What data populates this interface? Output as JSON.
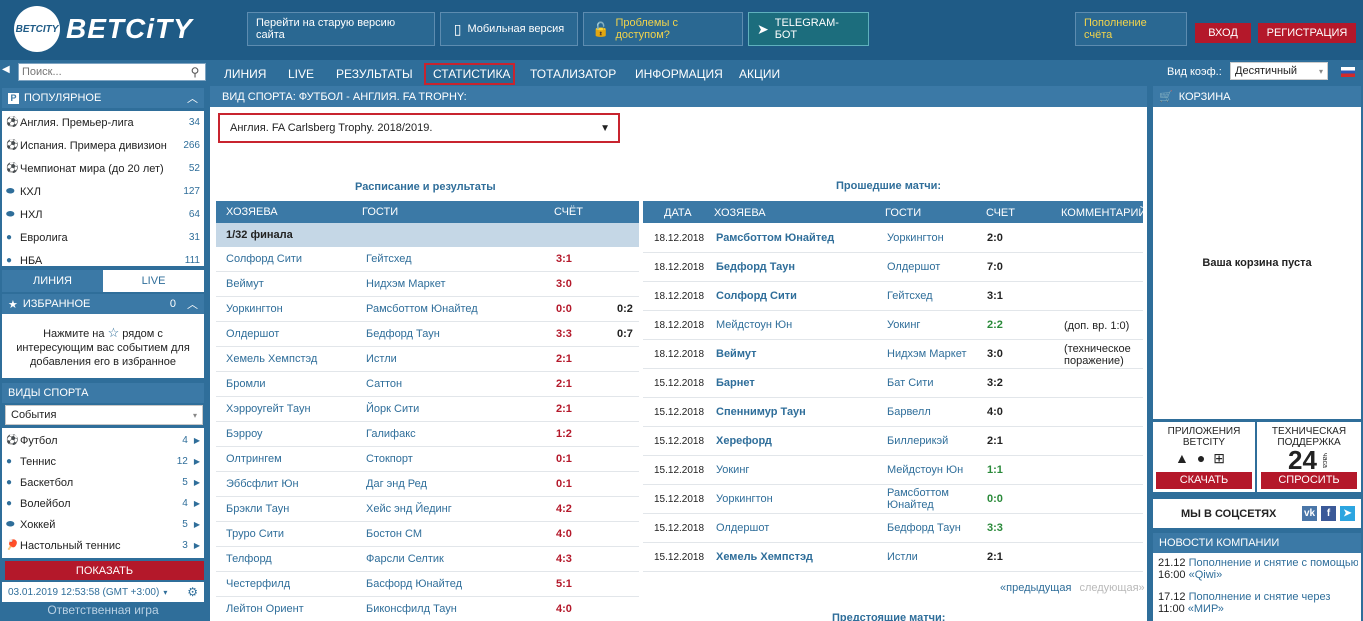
{
  "header": {
    "logo_ball": "BETCITY",
    "logo_text": "BETCiTY",
    "old_site": "Перейти на старую версию сайта",
    "mobile": "Мобильная версия",
    "access": "Проблемы с доступом?",
    "telegram": "TELEGRAM-БОТ",
    "deposit": "Пополнение счёта",
    "login": "ВХОД",
    "register": "РЕГИСТРАЦИЯ"
  },
  "search": {
    "placeholder": "Поиск..."
  },
  "nav": {
    "items": [
      "ЛИНИЯ",
      "LIVE",
      "РЕЗУЛЬТАТЫ",
      "СТАТИСТИКА",
      "ТОТАЛИЗАТОР",
      "ИНФОРМАЦИЯ",
      "АКЦИИ"
    ],
    "active": "СТАТИСТИКА",
    "koef_label": "Вид коэф.:",
    "koef_value": "Десятичный"
  },
  "popular": {
    "title": "ПОПУЛЯРНОЕ",
    "items": [
      {
        "name": "Англия. Премьер-лига",
        "count": "34"
      },
      {
        "name": "Испания. Примера дивизион",
        "count": "266"
      },
      {
        "name": "Чемпионат мира (до 20 лет)",
        "count": "52"
      },
      {
        "name": "КХЛ",
        "count": "127"
      },
      {
        "name": "НХЛ",
        "count": "64"
      },
      {
        "name": "Евролига",
        "count": "31"
      },
      {
        "name": "НБА",
        "count": "111"
      }
    ]
  },
  "tabs": {
    "line": "ЛИНИЯ",
    "live": "LIVE"
  },
  "favorites": {
    "title": "ИЗБРАННОЕ",
    "count": "0",
    "hint_1": "Нажмите на",
    "hint_2": "рядом с",
    "hint_3": "интересующим вас событием для",
    "hint_4": "добавления его в избранное"
  },
  "sports": {
    "title": "ВИДЫ СПОРТА",
    "select": "События",
    "items": [
      {
        "name": "Футбол",
        "count": "4"
      },
      {
        "name": "Теннис",
        "count": "12"
      },
      {
        "name": "Баскетбол",
        "count": "5"
      },
      {
        "name": "Волейбол",
        "count": "4"
      },
      {
        "name": "Хоккей",
        "count": "5"
      },
      {
        "name": "Настольный теннис",
        "count": "3"
      }
    ],
    "show_btn": "ПОКАЗАТЬ"
  },
  "footer_left": {
    "datetime": "03.01.2019 12:53:58 (GMT +3:00)",
    "responsible": "Ответственная игра"
  },
  "main": {
    "head": "ВИД СПОРТА: ФУТБОЛ - АНГЛИЯ. FA TROPHY:",
    "league": "Англия. FA Carlsberg Trophy. 2018/2019.",
    "schedule_title": "Расписание и результаты",
    "past_title": "Прошедшие матчи:",
    "upcoming_title": "Предстоящие матчи:",
    "left_cols": {
      "home": "ХОЗЯЕВА",
      "away": "ГОСТИ",
      "score": "СЧЁТ"
    },
    "right_cols": {
      "date": "ДАТА",
      "home": "ХОЗЯЕВА",
      "away": "ГОСТИ",
      "score": "СЧЕТ",
      "comment": "КОММЕНТАРИЙ"
    },
    "round": "1/32 финала",
    "schedule": [
      {
        "home": "Солфорд Сити",
        "away": "Гейтсхед",
        "score": "3:1",
        "extra": ""
      },
      {
        "home": "Веймут",
        "away": "Нидхэм Маркет",
        "score": "3:0",
        "extra": ""
      },
      {
        "home": "Уоркингтон",
        "away": "Рамсботтом Юнайтед",
        "score": "0:0",
        "extra": "0:2"
      },
      {
        "home": "Олдершот",
        "away": "Бедфорд Таун",
        "score": "3:3",
        "extra": "0:7"
      },
      {
        "home": "Хемель Хемпстэд",
        "away": "Истли",
        "score": "2:1",
        "extra": ""
      },
      {
        "home": "Бромли",
        "away": "Саттон",
        "score": "2:1",
        "extra": ""
      },
      {
        "home": "Хэрроугейт Таун",
        "away": "Йорк Сити",
        "score": "2:1",
        "extra": ""
      },
      {
        "home": "Бэрроу",
        "away": "Галифакс",
        "score": "1:2",
        "extra": ""
      },
      {
        "home": "Олтрингем",
        "away": "Стокпорт",
        "score": "0:1",
        "extra": ""
      },
      {
        "home": "Эббсфлит Юн",
        "away": "Даг энд Ред",
        "score": "0:1",
        "extra": ""
      },
      {
        "home": "Брэкли Таун",
        "away": "Хейс энд Йединг",
        "score": "4:2",
        "extra": ""
      },
      {
        "home": "Труро Сити",
        "away": "Бостон СМ",
        "score": "4:0",
        "extra": ""
      },
      {
        "home": "Телфорд",
        "away": "Фарсли Селтик",
        "score": "4:3",
        "extra": ""
      },
      {
        "home": "Честерфилд",
        "away": "Басфорд Юнайтед",
        "score": "5:1",
        "extra": ""
      },
      {
        "home": "Лейтон Ориент",
        "away": "Биконсфилд Таун",
        "score": "4:0",
        "extra": ""
      }
    ],
    "past": [
      {
        "date": "18.12.2018",
        "home": "Рамсботтом Юнайтед",
        "away": "Уоркингтон",
        "score": "2:0",
        "comment": "",
        "home_bold": true,
        "green": false
      },
      {
        "date": "18.12.2018",
        "home": "Бедфорд Таун",
        "away": "Олдершот",
        "score": "7:0",
        "comment": "",
        "home_bold": true,
        "green": false
      },
      {
        "date": "18.12.2018",
        "home": "Солфорд Сити",
        "away": "Гейтсхед",
        "score": "3:1",
        "comment": "",
        "home_bold": true,
        "green": false
      },
      {
        "date": "18.12.2018",
        "home": "Мейдстоун Юн",
        "away": "Уокинг",
        "score": "2:2",
        "comment": "(доп. вр. 1:0)",
        "home_bold": false,
        "green": true
      },
      {
        "date": "18.12.2018",
        "home": "Веймут",
        "away": "Нидхэм Маркет",
        "score": "3:0",
        "comment": "(техническое поражение)",
        "home_bold": true,
        "green": false
      },
      {
        "date": "15.12.2018",
        "home": "Барнет",
        "away": "Бат Сити",
        "score": "3:2",
        "comment": "",
        "home_bold": true,
        "green": false
      },
      {
        "date": "15.12.2018",
        "home": "Спеннимур Таун",
        "away": "Барвелл",
        "score": "4:0",
        "comment": "",
        "home_bold": true,
        "green": false
      },
      {
        "date": "15.12.2018",
        "home": "Херефорд",
        "away": "Биллерикэй",
        "score": "2:1",
        "comment": "",
        "home_bold": true,
        "green": false
      },
      {
        "date": "15.12.2018",
        "home": "Уокинг",
        "away": "Мейдстоун Юн",
        "score": "1:1",
        "comment": "",
        "home_bold": false,
        "green": true
      },
      {
        "date": "15.12.2018",
        "home": "Уоркингтон",
        "away": "Рамсботтом Юнайтед",
        "score": "0:0",
        "comment": "",
        "home_bold": false,
        "green": true
      },
      {
        "date": "15.12.2018",
        "home": "Олдершот",
        "away": "Бедфорд Таун",
        "score": "3:3",
        "comment": "",
        "home_bold": false,
        "green": true
      },
      {
        "date": "15.12.2018",
        "home": "Хемель Хемпстэд",
        "away": "Истли",
        "score": "2:1",
        "comment": "",
        "home_bold": true,
        "green": false
      }
    ],
    "pager_prev": "«предыдущая",
    "pager_next": "следующая»"
  },
  "cart": {
    "title": "КОРЗИНА",
    "empty": "Ваша корзина пуста"
  },
  "apps": {
    "title_1": "ПРИЛОЖЕНИЯ",
    "title_2": "BETCITY",
    "btn": "СКАЧАТЬ"
  },
  "support": {
    "title_1": "ТЕХНИЧЕСКАЯ",
    "title_2": "ПОДДЕРЖКА",
    "big": "24",
    "small": "часа",
    "btn": "СПРОСИТЬ"
  },
  "social": {
    "title": "МЫ В СОЦСЕТЯХ"
  },
  "news": {
    "title": "НОВОСТИ КОМПАНИИ",
    "items": [
      {
        "date": "21.12",
        "line1": "Пополнение и снятие с помощью",
        "time": "16:00",
        "line2": "«Qiwi»"
      },
      {
        "date": "17.12",
        "line1": "Пополнение и снятие через",
        "time": "11:00",
        "line2": "«МИР»"
      }
    ]
  },
  "colors": {
    "brand": "#1f5b86",
    "accent_red": "#b4182a",
    "header_bar": "#3b79a6",
    "score_red": "#b4182a",
    "score_green": "#2a8a3a"
  }
}
